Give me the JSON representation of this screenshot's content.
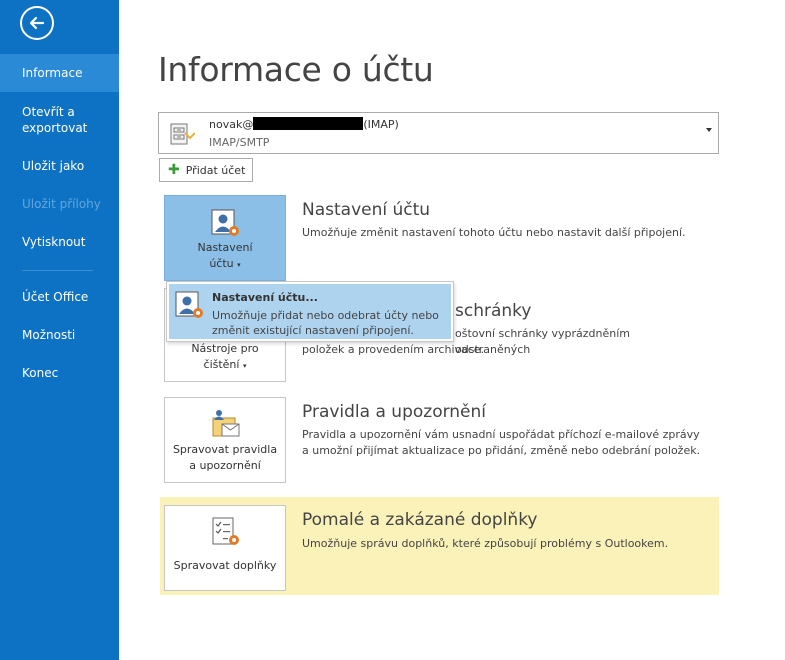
{
  "sidebar": {
    "items": [
      {
        "label": "Informace"
      },
      {
        "label": "Otevřít a exportovat"
      },
      {
        "label": "Uložit jako"
      },
      {
        "label": "Uložit přílohy"
      },
      {
        "label": "Vytisknout"
      },
      {
        "label": "Účet Office"
      },
      {
        "label": "Možnosti"
      },
      {
        "label": "Konec"
      }
    ]
  },
  "page": {
    "title": "Informace o účtu"
  },
  "account": {
    "email_prefix": "novak@",
    "email_suffix": "(IMAP)",
    "type": "IMAP/SMTP"
  },
  "add_account": {
    "label": "Přidat účet"
  },
  "sections": {
    "settings": {
      "tile_label_1": "Nastavení",
      "tile_label_2": "účtu",
      "title": "Nastavení účtu",
      "desc": "Umožňuje změnit nastavení tohoto účtu nebo nastavit další připojení."
    },
    "cleanup": {
      "tile_label_1": "Nástroje pro",
      "tile_label_2": "čištění",
      "title_partial": "schránky",
      "desc_1": "oštovní schránky vyprázdněním odstraněných",
      "desc_2": "položek a provedením archivace."
    },
    "rules": {
      "tile_label_1": "Spravovat pravidla",
      "tile_label_2": "a upozornění",
      "title": "Pravidla a upozornění",
      "desc": "Pravidla a upozornění vám usnadní uspořádat příchozí e-mailové zprávy a umožní přijímat aktualizace po přidání, změně nebo odebrání položek."
    },
    "addins": {
      "tile_label": "Spravovat doplňky",
      "title": "Pomalé a zakázané doplňky",
      "desc": "Umožňuje správu doplňků, které způsobují problémy s Outlookem."
    }
  },
  "dropdown": {
    "title": "Nastavení účtu...",
    "desc": "Umožňuje přidat nebo odebrat účty nebo změnit existující nastavení připojení."
  },
  "colors": {
    "sidebar": "#0e72c4",
    "sidebar_active": "#2a8ad6",
    "tile_selected": "#8cbfe7",
    "dropdown_hover": "#aed3ef",
    "warning_band": "#fbf2ba"
  }
}
